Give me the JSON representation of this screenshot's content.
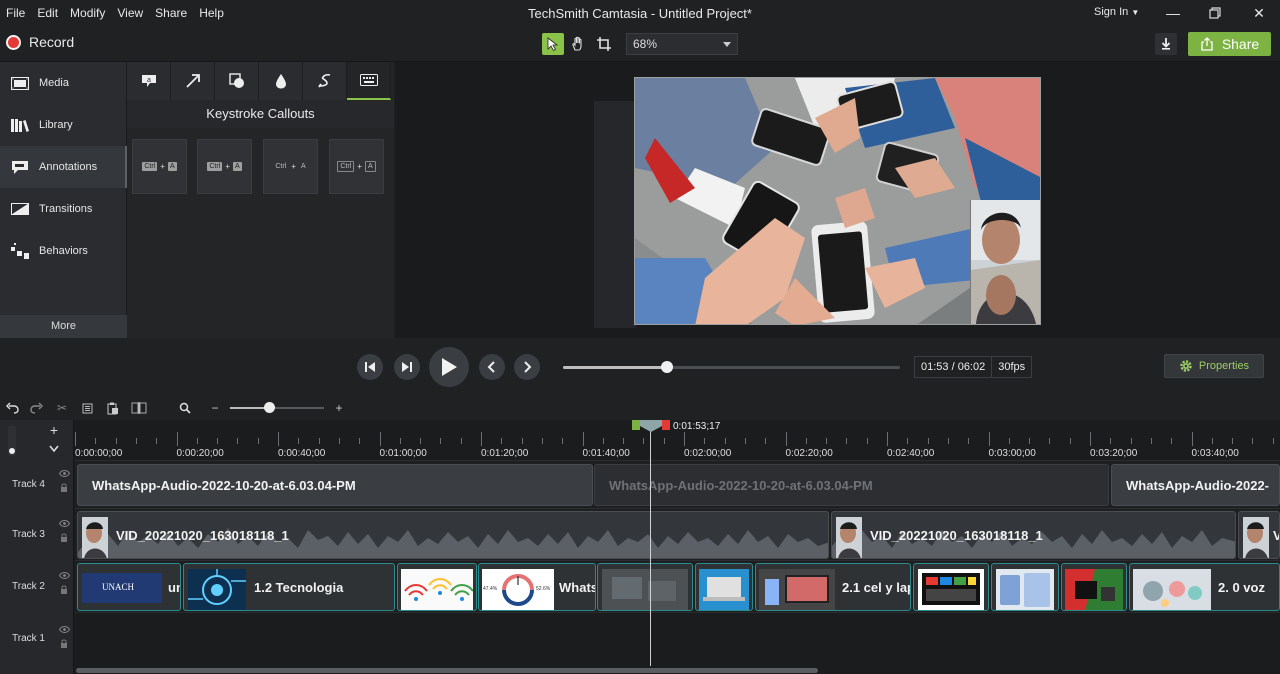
{
  "menu": [
    "File",
    "Edit",
    "Modify",
    "View",
    "Share",
    "Help"
  ],
  "window_title": "TechSmith Camtasia - Untitled Project*",
  "sign_in": "Sign In",
  "toolbar": {
    "record_label": "Record",
    "zoom_value": "68%",
    "share_label": "Share"
  },
  "sidebar": {
    "items": [
      {
        "label": "Media",
        "icon": "film-icon"
      },
      {
        "label": "Library",
        "icon": "books-icon"
      },
      {
        "label": "Annotations",
        "icon": "speech-bubble-icon"
      },
      {
        "label": "Transitions",
        "icon": "transition-icon"
      },
      {
        "label": "Behaviors",
        "icon": "behaviors-icon"
      }
    ],
    "more_label": "More"
  },
  "panel": {
    "title": "Keystroke Callouts",
    "tabs": [
      "callout-icon",
      "arrow-icon",
      "shapes-icon",
      "blur-icon",
      "sketch-icon",
      "keyboard-icon"
    ],
    "callouts": [
      {
        "key1": "Ctrl",
        "plus": "+",
        "key2": "A"
      },
      {
        "key1": "Ctrl",
        "plus": "+",
        "key2": "A"
      },
      {
        "key1": "Ctrl",
        "plus": "+",
        "key2": "A"
      },
      {
        "key1": "Ctrl",
        "plus": "+",
        "key2": "A"
      }
    ]
  },
  "playback": {
    "time": "01:53 / 06:02",
    "fps": "30fps",
    "progress": 0.31,
    "properties_label": "Properties"
  },
  "timeline": {
    "playhead_time": "0:01:53;17",
    "ticks": [
      "0:00:00;00",
      "0:00:20;00",
      "0:00:40;00",
      "0:01:00;00",
      "0:01:20;00",
      "0:01:40;00",
      "0:02:00;00",
      "0:02:20;00",
      "0:02:40;00",
      "0:03:00;00",
      "0:03:20;00",
      "0:03:40;00"
    ],
    "tracks": [
      {
        "label": "Track 4"
      },
      {
        "label": "Track 3"
      },
      {
        "label": "Track 2"
      },
      {
        "label": "Track 1"
      }
    ],
    "track4_clips": [
      "WhatsApp-Audio-2022-10-20-at-6.03.04-PM",
      "WhatsApp-Audio-2022-10-20-at-6.03.04-PM",
      "WhatsApp-Audio-2022-"
    ],
    "track3_clips": [
      "VID_20221020_163018118_1",
      "VID_20221020_163018118_1",
      "V"
    ],
    "track2_labels": {
      "unach": "UNACH",
      "un": "un",
      "tecnologia": "1.2 Tecnologia",
      "whats": "Whats",
      "pie_left": "47.4%",
      "pie_right": "52.6%",
      "celylap": "2.1 cel y lap",
      "voz": "2. 0 voz"
    }
  }
}
